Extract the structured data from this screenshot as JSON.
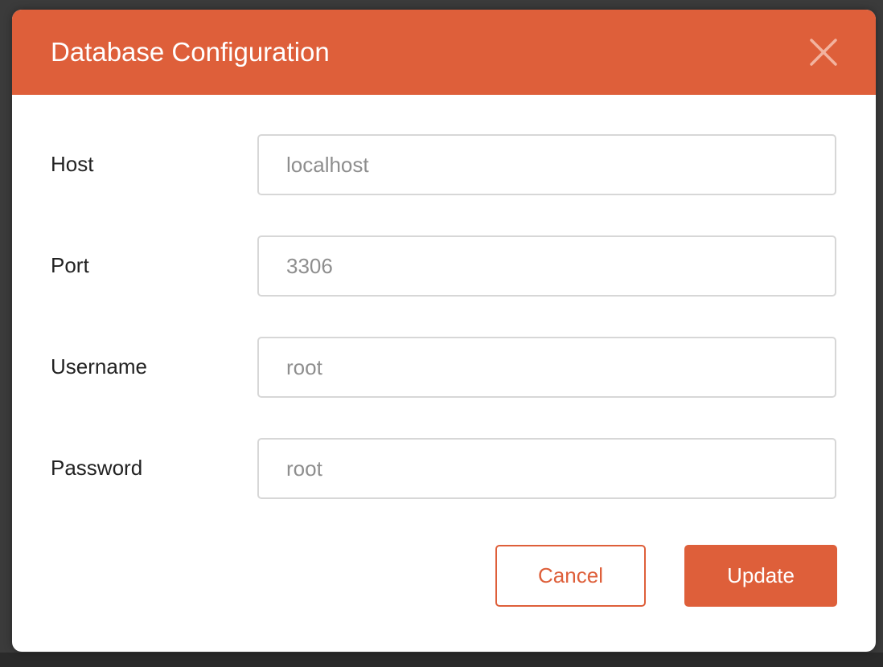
{
  "dialog": {
    "title": "Database Configuration",
    "close_icon": "close-icon"
  },
  "form": {
    "fields": [
      {
        "label": "Host",
        "placeholder": "localhost"
      },
      {
        "label": "Port",
        "placeholder": "3306"
      },
      {
        "label": "Username",
        "placeholder": "root"
      },
      {
        "label": "Password",
        "placeholder": "root"
      }
    ]
  },
  "actions": {
    "cancel_label": "Cancel",
    "update_label": "Update"
  },
  "colors": {
    "accent": "#de5f3a",
    "header_text": "#ffffff",
    "label_text": "#222222",
    "placeholder_text": "#8e8e8e",
    "field_border": "#d7d7d7"
  }
}
